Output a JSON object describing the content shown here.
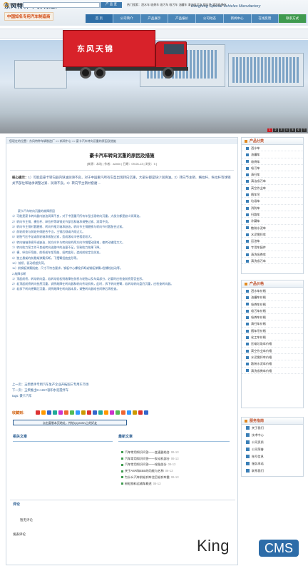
{
  "header": {
    "logo_cn": "东风特种车辆制造厂",
    "logo_sub": "中国知名专用汽车制造商",
    "logo_en": "Dongfeng Special Vehicles Manufactory",
    "nav": [
      "首 页",
      "公司简介",
      "产品展示",
      "产品报价",
      "公司动态",
      "新闻中心",
      "在线反馈",
      "联系方式"
    ]
  },
  "search": {
    "label": "快速搜索:",
    "placeholder": "",
    "button": "产 品 查",
    "hot_words": "热门搜索：洒水车 吸粪车 吸污车 吸污车 油罐车 清洁吸污车 随车吊 清洗吸粪车"
  },
  "banner": {
    "truck_brand": "东风天锦",
    "dots": [
      "1",
      "2",
      "3",
      "4",
      "5",
      "6",
      "7"
    ],
    "active_dot": 0
  },
  "breadcrumb": "您现在的位置：东风特种车辆制造厂 >> 新闻中心 >> 豪卡汽车转向沉重的原因及措施",
  "article": {
    "title": "豪卡汽车转向沉重的原因及措施",
    "meta": "[来源：本站 | 作者：admin | 日期：09-06-13 | 浏览：5 ]",
    "summary_label": "核心提示：",
    "summary": "1）可能是豪卡转向器内缺油润滑不良，对于中国重汽所有车型出现转向沉重，大部分都是缺少润滑油。2）转向节主销、横拉杆、纵拉杆等球销关节部位和轴承调整过紧、润滑不良。3）转向节主销衬套磨 ...",
    "body": [
      "豪卡汽车转向沉重的故障原因",
      "1）可能是豪卡转向器内缺油润滑不良，对于中国重汽所有车型出现转向沉重，大部分都是缺少润滑油。",
      "2）转向节主销、横拉杆、纵拉杆等球销关节部位和轴承调整过紧、润滑不良。",
      "3）转向节主销衬套磨损、转向节推力轴承缺油，转向节主销磨损与转向节衬套配合过紧。",
      "4）前轮前束与前轮外倾配合不当，主销后倾或内倾过大。",
      "5）轮胎气压不足或前轮轴承紧配过紧，造成滚动半径相差较大。",
      "6）转向轴轴承损坏或缺油，前方向节与转向轮的两方向节销摆动困难，使转动输阻力大。",
      "7）转向助力泵工作不良或转向油路中的油量不足，导致助力效果下降。",
      "8）横、纵拉杆弯曲、前桥或车架弯曲、扭转变形，造成前轮定位失准。",
      "9）独立悬架的前悬架弹簧折断，下摆臂扭曲变形等。",
      "10）前桥、驱动桥超负荷。",
      "11）前钢板弹簧挠度、尺寸不符合要求，钢板中心螺栓折断或钢板弹簧U型螺栓松动等。",
      "2.故障诊断",
      "1）顶起前桥，转动转向盘，若转动轻松则故障在前桥与轮胎以及车架部分，必要时应检查前桥是否变形。",
      "2）若顶起前桥转向依然沉重，说明故障在转向器和转向传动机构，此时，拆下转向摇臂，若转动转向盘仍沉重，应检查转向器。",
      "3）若拆下转向摇臂后沉重，说明故障在转向器本身，调整转向器啮合间隙后再检查。"
    ],
    "prev": "上一页：玉柴携手专用汽车生产企业开拓国三专用车市场",
    "next": "下一页：玉柴推出8~12m³容积水泥搅拌车",
    "tags": "tags: 豪卡汽车",
    "fav_label": "收藏到：",
    "copy_btn": "点击复制本页地址，传给QQ/MSN上的好友"
  },
  "related": {
    "label": "相关文章"
  },
  "latest": {
    "label": "最新文章",
    "items": [
      {
        "text": "汽车常用知识问答——变速器结合",
        "date": "06-13"
      },
      {
        "text": "汽车常用知识问答——发动机部分",
        "date": "06-13"
      },
      {
        "text": "汽车常用知识问答——轮胎部分",
        "date": "06-13"
      },
      {
        "text": "关于ASR和EBS的功能与名称",
        "date": "06-13"
      },
      {
        "text": "为什么汽车前轮刹车比后轮刹车重",
        "date": "06-13"
      },
      {
        "text": "粉粒物料运输车概述",
        "date": "06-13"
      }
    ]
  },
  "comments": {
    "label": "评论",
    "empty": "暂无评论",
    "post_label": "发表评论"
  },
  "sidebar": {
    "products_title": "产品分类",
    "products": [
      "洒水车",
      "油罐车",
      "吸粪车",
      "吸污车",
      "清扫车",
      "清洁吸污车",
      "高空作业车",
      "随车吊",
      "垃圾车",
      "消防车",
      "扫路车",
      "冷藏车",
      "散装水泥车",
      "水泥搅拌车",
      "运油车",
      "专用车配件",
      "清洗吸粪车",
      "清洗吸污车"
    ],
    "prices_title": "产品价格",
    "prices": [
      "洒水车价格",
      "油罐车价格",
      "吸粪车价格",
      "吸污车价格",
      "吸粪车价格",
      "清扫车价格",
      "随车吊价格",
      "化工车价格",
      "压缩垃圾车价格",
      "高空作业车价格",
      "水泥搅拌车价格",
      "散装水泥车价格",
      "清洗吸粪车价格"
    ],
    "service_title": "服务指南",
    "service": [
      "关于我们",
      "技术中心",
      "公司资质",
      "公司荣誉",
      "账号信息",
      "服务承诺",
      "联系我们"
    ]
  },
  "footer": {
    "brand": "King",
    "badge": "CMS"
  },
  "colors": {
    "nav_blue": "#4a86b8",
    "accent_green": "#3f9a4f",
    "truck_red": "#d8222a"
  }
}
